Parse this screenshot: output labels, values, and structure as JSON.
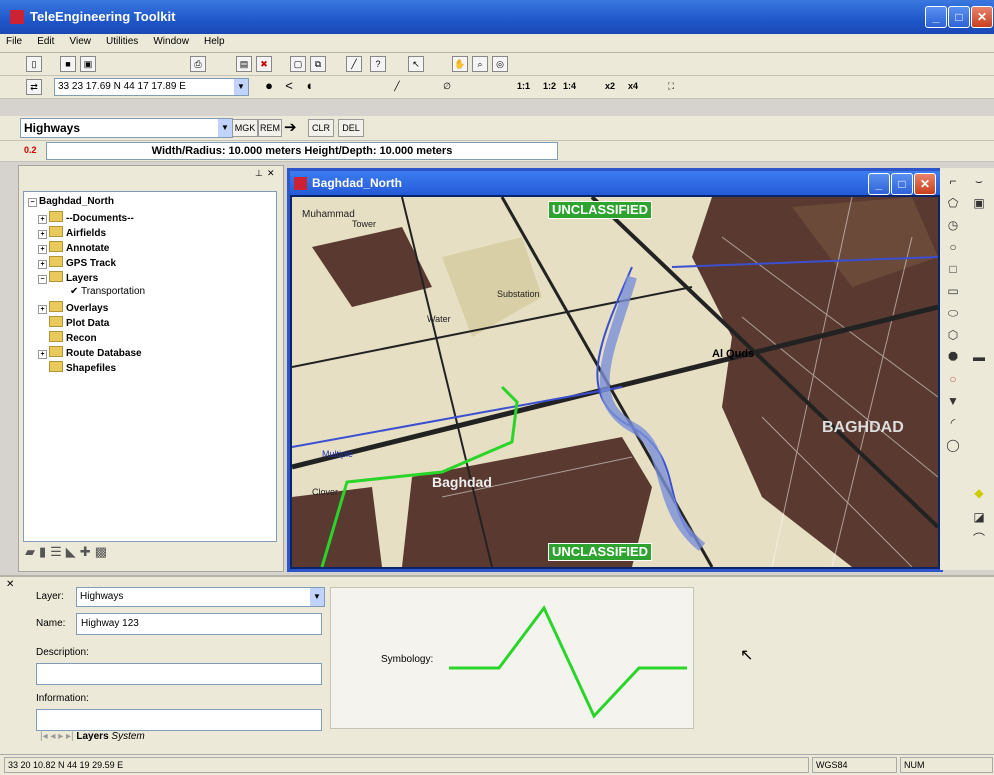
{
  "window": {
    "title": "TeleEngineering Toolkit"
  },
  "menu": [
    "File",
    "Edit",
    "View",
    "Utilities",
    "Window",
    "Help"
  ],
  "toolbar2": {
    "coordinates": "33 23 17.69 N 44 17 17.89 E",
    "zoom_buttons": [
      "1:1",
      "1:2",
      "1:4",
      "x2",
      "x4"
    ]
  },
  "toolbar3": {
    "layer_select": "Highways",
    "buttons": [
      "MGK",
      "REM",
      "CLR",
      "DEL"
    ]
  },
  "toolbar4": {
    "prefix": "0.2",
    "info": "Width/Radius: 10.000 meters Height/Depth: 10.000 meters"
  },
  "tree": {
    "root": "Baghdad_North",
    "items": [
      "--Documents--",
      "Airfields",
      "Annotate",
      "GPS Track",
      "Layers",
      "Transportation",
      "Overlays",
      "Plot Data",
      "Recon",
      "Route Database",
      "Shapefiles"
    ]
  },
  "map": {
    "title": "Baghdad_North",
    "banner_top": "UNCLASSIFIED",
    "banner_bottom": "UNCLASSIFIED",
    "labels": [
      "Baghdad",
      "BAGHDAD",
      "Multiple",
      "Water",
      "Substation",
      "Al Quds",
      "Tower",
      "Clover"
    ]
  },
  "properties": {
    "layer_label": "Layer:",
    "layer_value": "Highways",
    "name_label": "Name:",
    "name_value": "Highway 123",
    "description_label": "Description:",
    "information_label": "Information:",
    "symbology_label": "Symbology:",
    "tabs": [
      "Layers",
      "System"
    ]
  },
  "status": {
    "coords": "33 20 10.82 N 44 19 29.59 E",
    "datum": "WGS84",
    "num": "NUM"
  },
  "colors": {
    "accent": "#2d54c8",
    "highway": "#2ad52a"
  }
}
